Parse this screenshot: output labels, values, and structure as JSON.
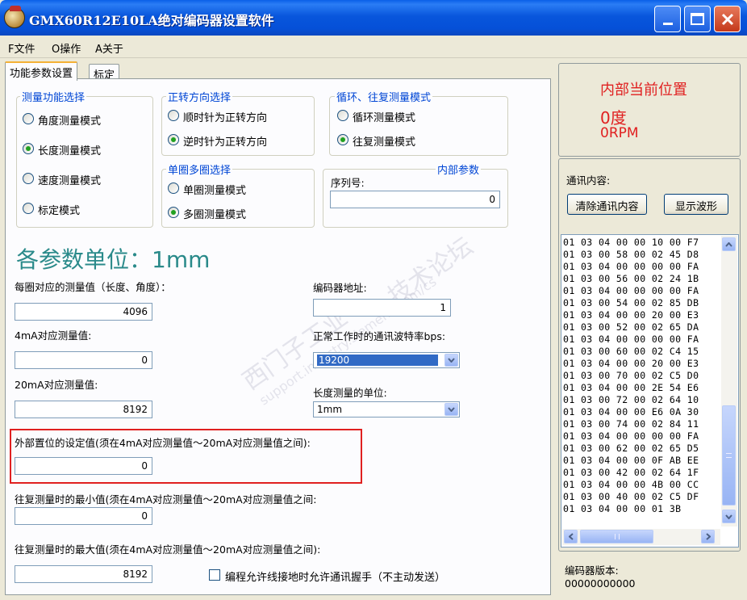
{
  "window": {
    "title": "GMX60R12E10LA绝对编码器设置软件"
  },
  "menu": {
    "items": [
      "F文件",
      "O操作",
      "A关于"
    ]
  },
  "tabs": [
    {
      "label": "功能参数设置"
    },
    {
      "label": "标定"
    }
  ],
  "measure_mode": {
    "legend": "测量功能选择",
    "options": [
      "角度测量模式",
      "长度测量模式",
      "速度测量模式",
      "标定模式"
    ],
    "selected": "长度测量模式"
  },
  "direction": {
    "legend": "正转方向选择",
    "options": [
      "顺时针为正转方向",
      "逆时针为正转方向"
    ],
    "selected": "逆时针为正转方向"
  },
  "cycle_mode": {
    "legend": "循环、往复测量模式",
    "options": [
      "循环测量模式",
      "往复测量模式"
    ],
    "selected": "往复测量模式"
  },
  "turn_mode": {
    "legend": "单圈多圈选择",
    "options": [
      "单圈测量模式",
      "多圈测量模式"
    ],
    "selected": "多圈测量模式"
  },
  "internal_params": {
    "legend": "内部参数",
    "serial_label": "序列号:",
    "serial_value": "0"
  },
  "units_heading": "各参数单位：1mm",
  "fields": {
    "per_turn_label": "每圈对应的测量值（长度、角度）：",
    "per_turn_value": "4096",
    "ma4_label": "4mA对应测量值:",
    "ma4_value": "0",
    "ma20_label": "20mA对应测量值:",
    "ma20_value": "8192",
    "preset_label": "外部置位的设定值(须在4mA对应测量值～20mA对应测量值之间):",
    "preset_value": "0",
    "recip_min_label": "往复测量时的最小值(须在4mA对应测量值～20mA对应测量值之间:",
    "recip_min_value": "0",
    "recip_max_label": "往复测量时的最大值(须在4mA对应测量值～20mA对应测量值之间):",
    "recip_max_value": "8192",
    "addr_label": "编码器地址:",
    "addr_value": "1",
    "baud_label": "正常工作时的通讯波特率bps:",
    "baud_value": "19200",
    "length_unit_label": "长度测量的单位:",
    "length_unit_value": "1mm",
    "handshake_label": "编程允许线接地时允许通讯握手（不主动发送）"
  },
  "position": {
    "title": "内部当前位置",
    "angle": "0度",
    "rpm": "0RPM"
  },
  "comm": {
    "label": "通讯内容:",
    "clear_button": "清除通讯内容",
    "wave_button": "显示波形",
    "lines": [
      "01 03 04 00 00 10 00 F7",
      "01 03 00 58 00 02 45 D8",
      "01 03 04 00 00 00 00 FA",
      "01 03 00 56 00 02 24 1B",
      "01 03 04 00 00 00 00 FA",
      "01 03 00 54 00 02 85 DB",
      "01 03 04 00 00 20 00 E3",
      "01 03 00 52 00 02 65 DA",
      "01 03 04 00 00 00 00 FA",
      "01 03 00 60 00 02 C4 15",
      "01 03 04 00 00 20 00 E3",
      "01 03 00 70 00 02 C5 D0",
      "01 03 04 00 00 2E 54 E6",
      "01 03 00 72 00 02 64 10",
      "01 03 04 00 00 E6 0A 30",
      "01 03 00 74 00 02 84 11",
      "01 03 04 00 00 00 00 FA",
      "01 03 00 62 00 02 65 D5",
      "01 03 04 00 00 0F AB EE",
      "01 03 00 42 00 02 64 1F",
      "01 03 04 00 00 4B 00 CC",
      "01 03 00 40 00 02 C5 DF",
      "01 03 04 00 00 01 3B"
    ]
  },
  "version": {
    "label": "编码器版本:",
    "value": "00000000000"
  },
  "watermark": {
    "text1": "西门子工业",
    "text2": "技术论坛",
    "text3": "support.industry.siemens.com/cs"
  },
  "colors": {
    "accent_red": "#e02020",
    "group_legend": "#0046d5",
    "units_teal": "#2a8a8a",
    "radio_dot": "#21a121"
  }
}
